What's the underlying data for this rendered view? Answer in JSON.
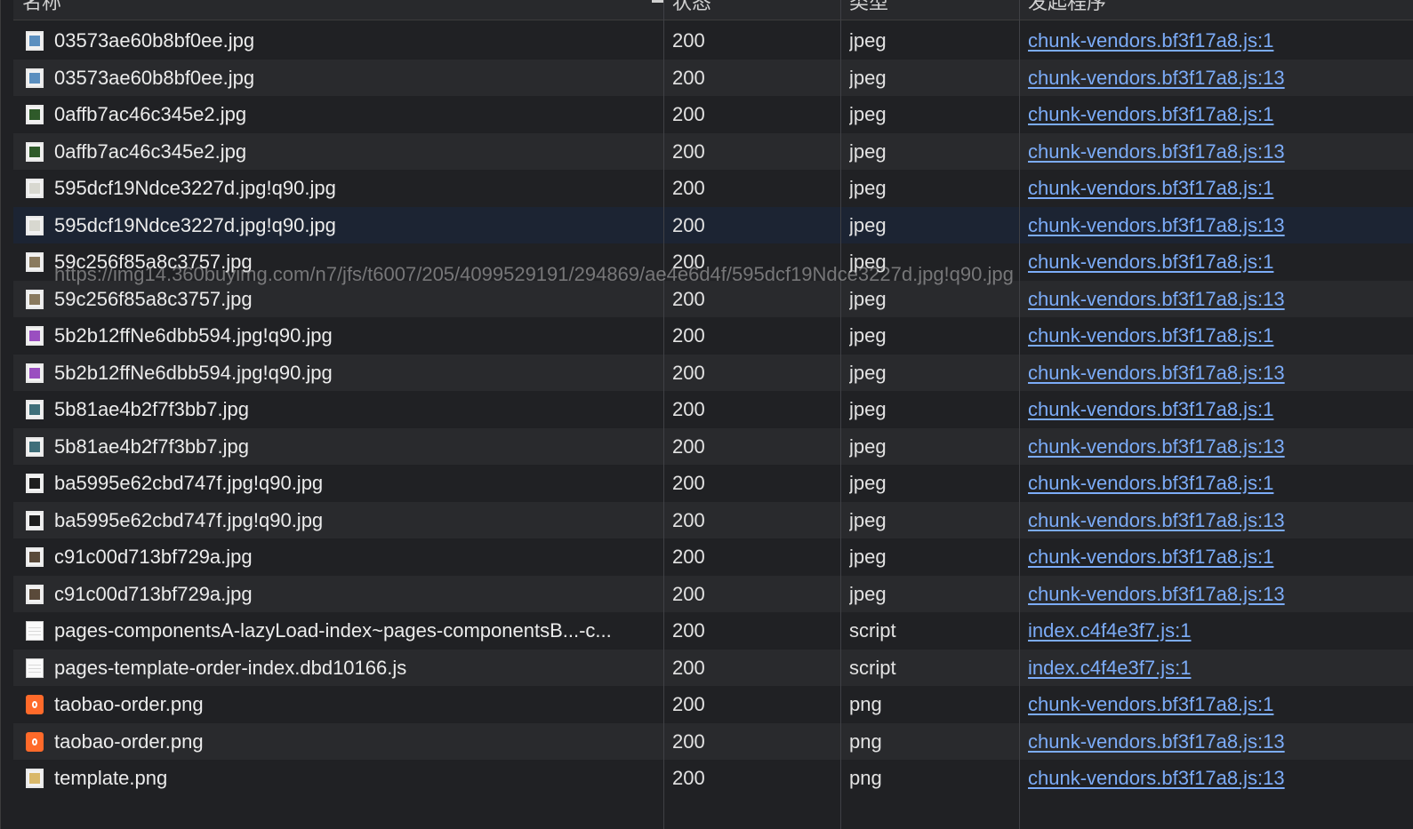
{
  "header": {
    "col_name": "名称",
    "col_status": "状态",
    "col_type": "类型",
    "col_initiator": "发起程序"
  },
  "hover_url": "https://img14.360buyimg.com/n7/jfs/t6007/205/4099529191/294869/ae4e6d4f/595dcf19Ndce3227d.jpg!q90.jpg",
  "rows": [
    {
      "name": "03573ae60b8bf0ee.jpg",
      "status": "200",
      "type": "jpeg",
      "initiator": "chunk-vendors.bf3f17a8.js:1",
      "icon": "image-thumb-icon",
      "thumb": "#5b8fbf"
    },
    {
      "name": "03573ae60b8bf0ee.jpg",
      "status": "200",
      "type": "jpeg",
      "initiator": "chunk-vendors.bf3f17a8.js:13",
      "icon": "image-thumb-icon",
      "thumb": "#5b8fbf"
    },
    {
      "name": "0affb7ac46c345e2.jpg",
      "status": "200",
      "type": "jpeg",
      "initiator": "chunk-vendors.bf3f17a8.js:1",
      "icon": "image-thumb-icon",
      "thumb": "#2f5a2a"
    },
    {
      "name": "0affb7ac46c345e2.jpg",
      "status": "200",
      "type": "jpeg",
      "initiator": "chunk-vendors.bf3f17a8.js:13",
      "icon": "image-thumb-icon",
      "thumb": "#2f5a2a"
    },
    {
      "name": "595dcf19Ndce3227d.jpg!q90.jpg",
      "status": "200",
      "type": "jpeg",
      "initiator": "chunk-vendors.bf3f17a8.js:1",
      "icon": "image-thumb-icon",
      "thumb": "#d8d8d0"
    },
    {
      "name": "595dcf19Ndce3227d.jpg!q90.jpg",
      "status": "200",
      "type": "jpeg",
      "initiator": "chunk-vendors.bf3f17a8.js:13",
      "icon": "image-thumb-icon",
      "thumb": "#d8d8d0",
      "selected": true
    },
    {
      "name": "59c256f85a8c3757.jpg",
      "status": "200",
      "type": "jpeg",
      "initiator": "chunk-vendors.bf3f17a8.js:1",
      "icon": "image-thumb-icon",
      "thumb": "#8a7a5e"
    },
    {
      "name": "59c256f85a8c3757.jpg",
      "status": "200",
      "type": "jpeg",
      "initiator": "chunk-vendors.bf3f17a8.js:13",
      "icon": "image-thumb-icon",
      "thumb": "#8a7a5e"
    },
    {
      "name": "5b2b12ffNe6dbb594.jpg!q90.jpg",
      "status": "200",
      "type": "jpeg",
      "initiator": "chunk-vendors.bf3f17a8.js:1",
      "icon": "image-thumb-icon",
      "thumb": "#9a4fc0"
    },
    {
      "name": "5b2b12ffNe6dbb594.jpg!q90.jpg",
      "status": "200",
      "type": "jpeg",
      "initiator": "chunk-vendors.bf3f17a8.js:13",
      "icon": "image-thumb-icon",
      "thumb": "#9a4fc0"
    },
    {
      "name": "5b81ae4b2f7f3bb7.jpg",
      "status": "200",
      "type": "jpeg",
      "initiator": "chunk-vendors.bf3f17a8.js:1",
      "icon": "image-thumb-icon",
      "thumb": "#3f6f7a"
    },
    {
      "name": "5b81ae4b2f7f3bb7.jpg",
      "status": "200",
      "type": "jpeg",
      "initiator": "chunk-vendors.bf3f17a8.js:13",
      "icon": "image-thumb-icon",
      "thumb": "#3f6f7a"
    },
    {
      "name": "ba5995e62cbd747f.jpg!q90.jpg",
      "status": "200",
      "type": "jpeg",
      "initiator": "chunk-vendors.bf3f17a8.js:1",
      "icon": "image-thumb-icon",
      "thumb": "#1e1e1e"
    },
    {
      "name": "ba5995e62cbd747f.jpg!q90.jpg",
      "status": "200",
      "type": "jpeg",
      "initiator": "chunk-vendors.bf3f17a8.js:13",
      "icon": "image-thumb-icon",
      "thumb": "#1e1e1e"
    },
    {
      "name": "c91c00d713bf729a.jpg",
      "status": "200",
      "type": "jpeg",
      "initiator": "chunk-vendors.bf3f17a8.js:1",
      "icon": "image-thumb-icon",
      "thumb": "#5a4a3a"
    },
    {
      "name": "c91c00d713bf729a.jpg",
      "status": "200",
      "type": "jpeg",
      "initiator": "chunk-vendors.bf3f17a8.js:13",
      "icon": "image-thumb-icon",
      "thumb": "#5a4a3a"
    },
    {
      "name": "pages-componentsA-lazyLoad-index~pages-componentsB...-c...",
      "status": "200",
      "type": "script",
      "initiator": "index.c4f4e3f7.js:1",
      "icon": "script-file-icon"
    },
    {
      "name": "pages-template-order-index.dbd10166.js",
      "status": "200",
      "type": "script",
      "initiator": "index.c4f4e3f7.js:1",
      "icon": "script-file-icon"
    },
    {
      "name": "taobao-order.png",
      "status": "200",
      "type": "png",
      "initiator": "chunk-vendors.bf3f17a8.js:1",
      "icon": "taobao-logo-icon"
    },
    {
      "name": "taobao-order.png",
      "status": "200",
      "type": "png",
      "initiator": "chunk-vendors.bf3f17a8.js:13",
      "icon": "taobao-logo-icon"
    },
    {
      "name": "template.png",
      "status": "200",
      "type": "png",
      "initiator": "chunk-vendors.bf3f17a8.js:13",
      "icon": "image-thumb-icon",
      "thumb": "#d9b86a"
    }
  ]
}
